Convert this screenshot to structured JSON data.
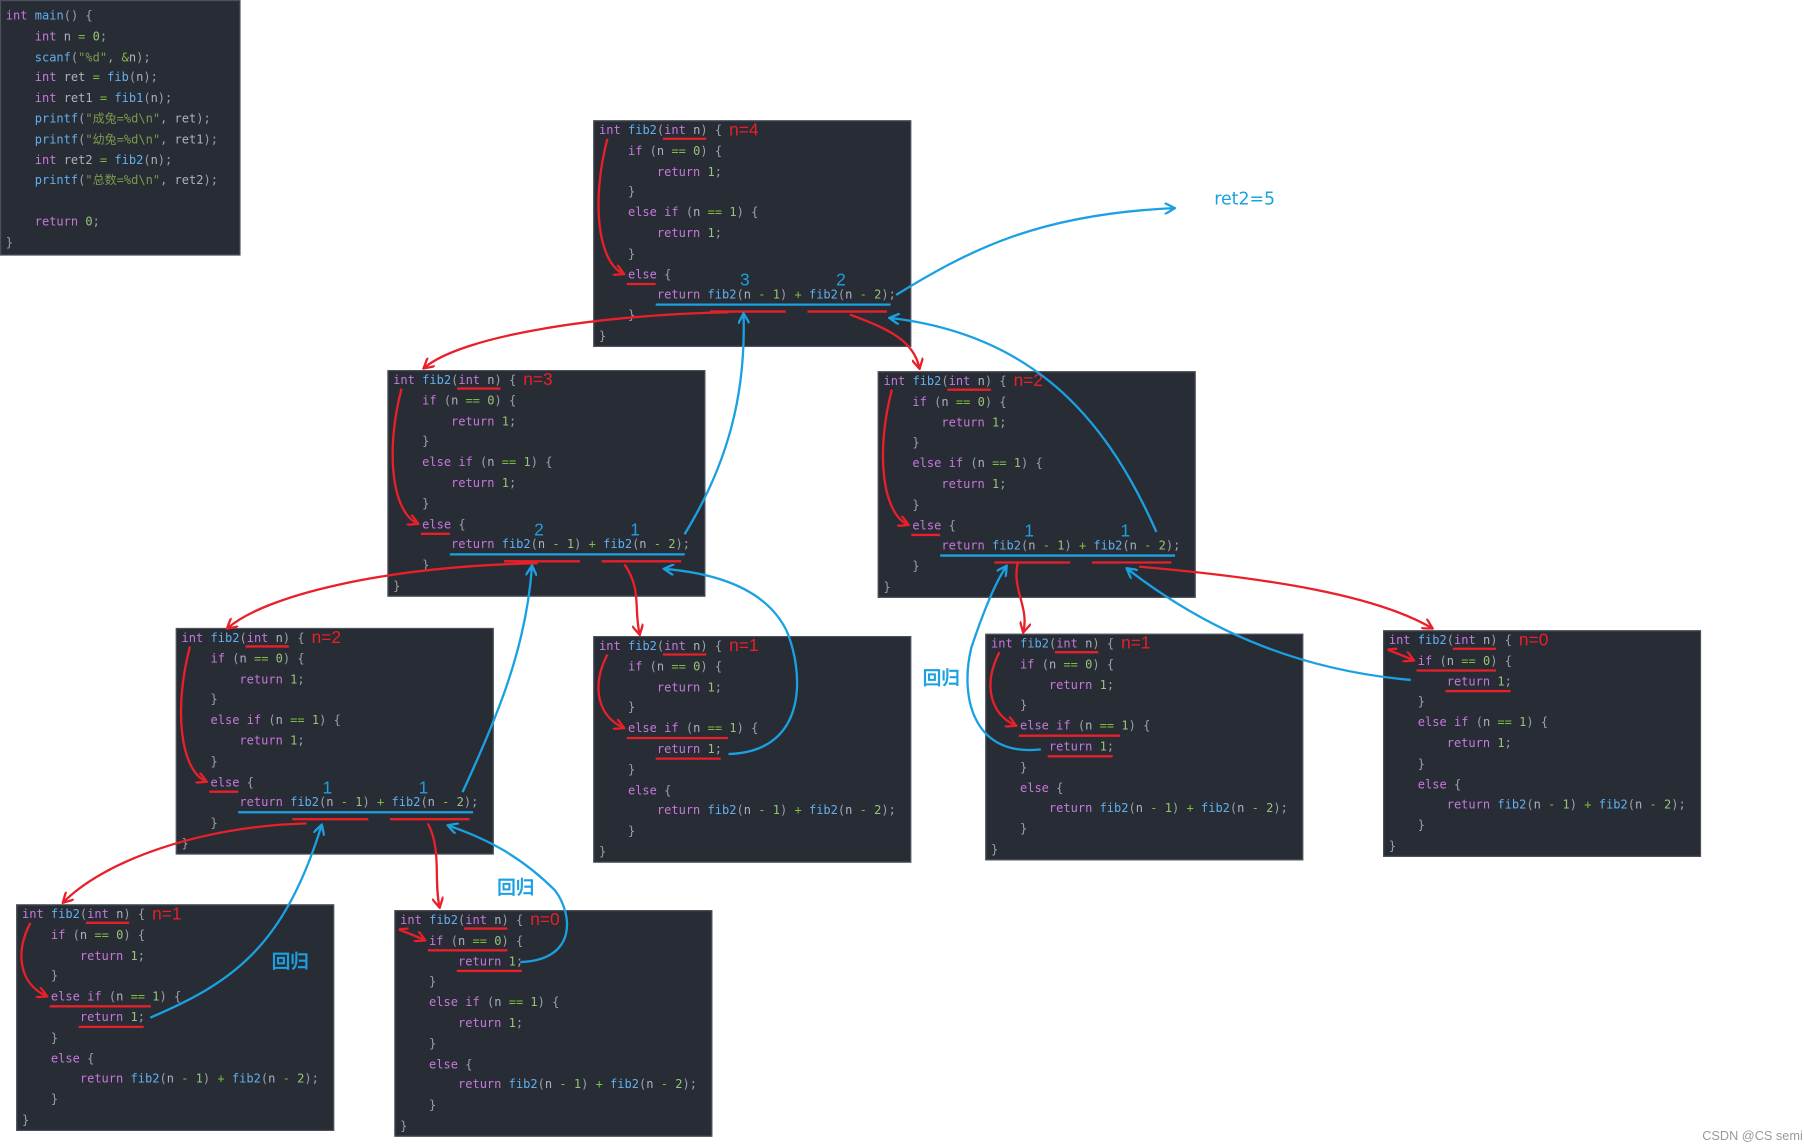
{
  "main_code": [
    "int main() {",
    "    int n = 0;",
    "    scanf(\"%d\", &n);",
    "    int ret = fib(n);",
    "    int ret1 = fib1(n);",
    "    printf(\"成兔=%d\\n\", ret);",
    "    printf(\"幼兔=%d\\n\", ret1);",
    "    int ret2 = fib2(n);",
    "    printf(\"总数=%d\\n\", ret2);",
    "",
    "    return 0;",
    "}"
  ],
  "fib2_code": [
    "int fib2(int n) {",
    "    if (n == 0) {",
    "        return 1;",
    "    }",
    "    else if (n == 1) {",
    "        return 1;",
    "    }",
    "    else {",
    "        return fib2(n - 1) + fib2(n - 2);",
    "    }",
    "}"
  ],
  "boxes": [
    {
      "n_label": "n=4",
      "kind": "else",
      "results": [
        "3",
        "2"
      ]
    },
    {
      "n_label": "n=3",
      "kind": "else",
      "results": [
        "2",
        "1"
      ]
    },
    {
      "n_label": "n=2",
      "kind": "else",
      "results": [
        "1",
        "1"
      ]
    },
    {
      "n_label": "n=2",
      "kind": "else",
      "results": [
        "1",
        "1"
      ]
    },
    {
      "n_label": "n=1",
      "kind": "n1",
      "results": []
    },
    {
      "n_label": "n=1",
      "kind": "n1",
      "results": []
    },
    {
      "n_label": "n=0",
      "kind": "n0",
      "results": []
    },
    {
      "n_label": "n=1",
      "kind": "n1",
      "results": []
    },
    {
      "n_label": "n=0",
      "kind": "n0",
      "results": []
    }
  ],
  "annotations": {
    "ret2_label": "ret2=5",
    "return_labels": [
      "回归",
      "回归",
      "回归"
    ],
    "watermark": "CSDN @CS semi"
  },
  "colors": {
    "call_arrow": "#e8202a",
    "return_arrow": "#1ba1e2",
    "code_bg": "#282c34",
    "keyword": "#c678dd",
    "function": "#61afef",
    "number": "#98c379"
  }
}
